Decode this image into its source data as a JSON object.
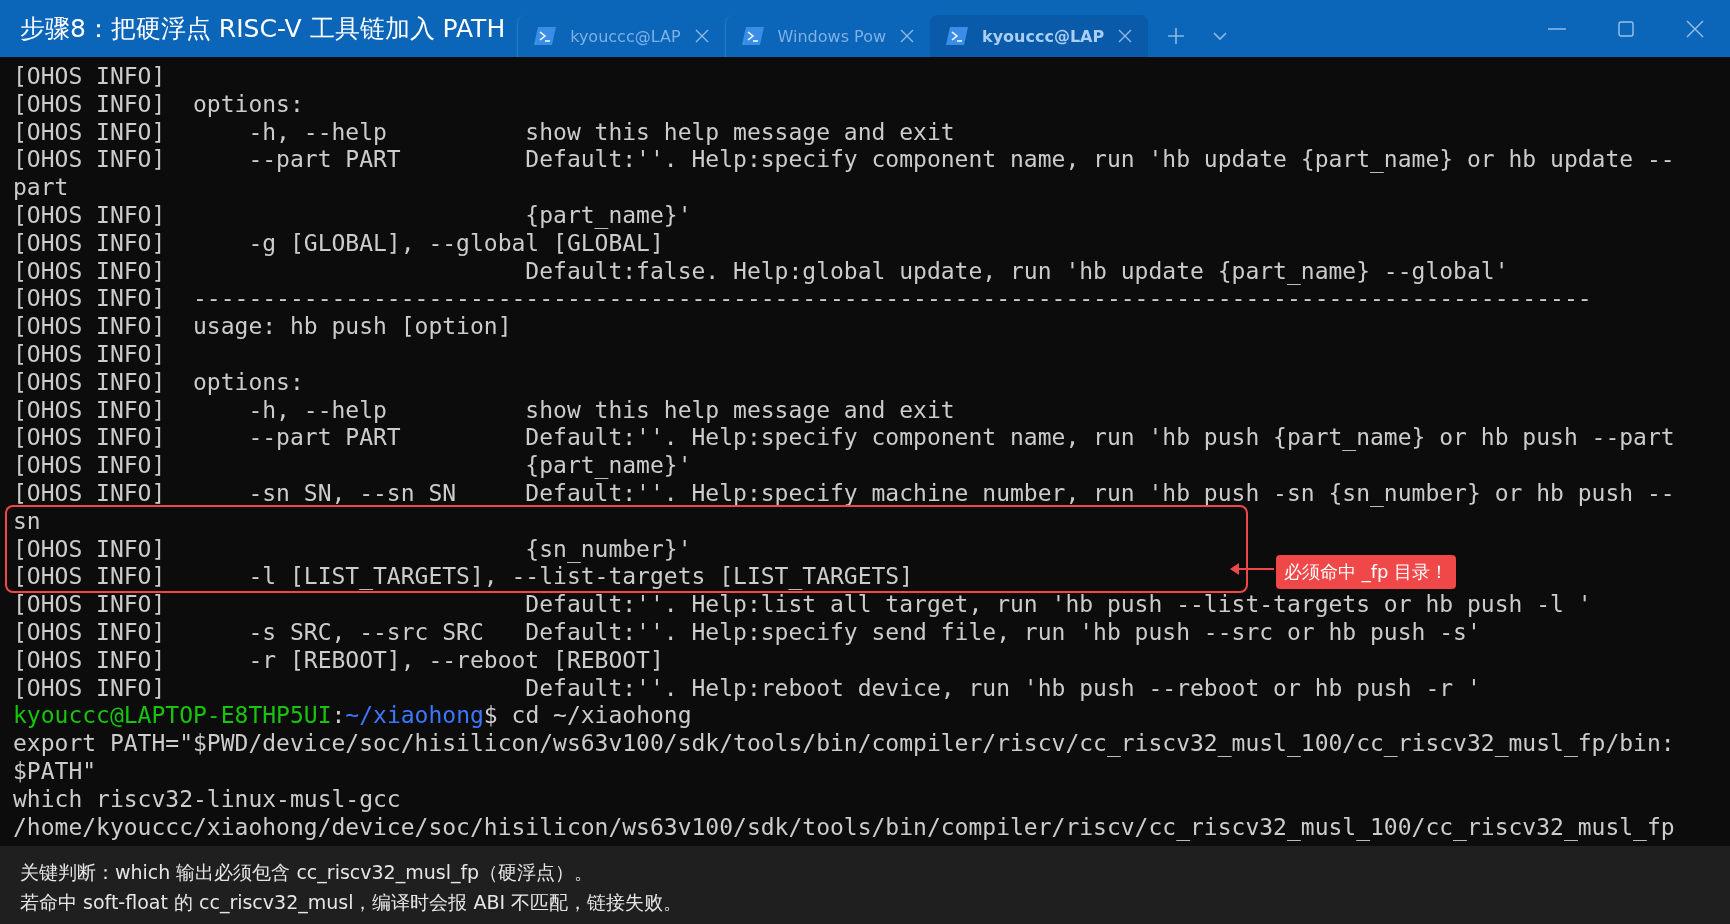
{
  "window": {
    "title": "步骤8：把硬浮点 RISC-V 工具链加入 PATH"
  },
  "tabs": [
    {
      "label": "kyouccc@LAP",
      "selected": false
    },
    {
      "label": "Windows Pow",
      "selected": false
    },
    {
      "label": "kyouccc@LAP",
      "selected": true
    }
  ],
  "terminal": {
    "lines": [
      {
        "kind": "text",
        "text": "[OHOS INFO]"
      },
      {
        "kind": "text",
        "text": "[OHOS INFO]  options:"
      },
      {
        "kind": "text",
        "text": "[OHOS INFO]      -h, --help          show this help message and exit"
      },
      {
        "kind": "text",
        "text": "[OHOS INFO]      --part PART         Default:''. Help:specify component name, run 'hb update {part_name} or hb update --"
      },
      {
        "kind": "text",
        "text": "part"
      },
      {
        "kind": "text",
        "text": "[OHOS INFO]                          {part_name}'"
      },
      {
        "kind": "text",
        "text": "[OHOS INFO]      -g [GLOBAL], --global [GLOBAL]"
      },
      {
        "kind": "text",
        "text": "[OHOS INFO]                          Default:false. Help:global update, run 'hb update {part_name} --global'"
      },
      {
        "kind": "text",
        "text": "[OHOS INFO]  -----------------------------------------------------------------------------------------------------"
      },
      {
        "kind": "text",
        "text": "[OHOS INFO]  usage: hb push [option]"
      },
      {
        "kind": "text",
        "text": "[OHOS INFO]"
      },
      {
        "kind": "text",
        "text": "[OHOS INFO]  options:"
      },
      {
        "kind": "text",
        "text": "[OHOS INFO]      -h, --help          show this help message and exit"
      },
      {
        "kind": "text",
        "text": "[OHOS INFO]      --part PART         Default:''. Help:specify component name, run 'hb push {part_name} or hb push --part"
      },
      {
        "kind": "text",
        "text": "[OHOS INFO]                          {part_name}'"
      },
      {
        "kind": "text",
        "text": "[OHOS INFO]      -sn SN, --sn SN     Default:''. Help:specify machine number, run 'hb push -sn {sn_number} or hb push --"
      },
      {
        "kind": "text",
        "text": "sn"
      },
      {
        "kind": "text",
        "text": "[OHOS INFO]                          {sn_number}'"
      },
      {
        "kind": "text",
        "text": "[OHOS INFO]      -l [LIST_TARGETS], --list-targets [LIST_TARGETS]"
      },
      {
        "kind": "text",
        "text": "[OHOS INFO]                          Default:''. Help:list all target, run 'hb push --list-targets or hb push -l '"
      },
      {
        "kind": "text",
        "text": "[OHOS INFO]      -s SRC, --src SRC   Default:''. Help:specify send file, run 'hb push --src or hb push -s'"
      },
      {
        "kind": "text",
        "text": "[OHOS INFO]      -r [REBOOT], --reboot [REBOOT]"
      },
      {
        "kind": "text",
        "text": "[OHOS INFO]                          Default:''. Help:reboot device, run 'hb push --reboot or hb push -r '"
      },
      {
        "kind": "prompt",
        "parts": [
          {
            "text": "kyouccc@LAPTOP-E8THP5UI",
            "color": "#16c60c"
          },
          {
            "text": ":",
            "color": "#cccccc"
          },
          {
            "text": "~/xiaohong",
            "color": "#3b78ff"
          },
          {
            "text": "$ cd ~/xiaohong",
            "color": "#cccccc"
          }
        ]
      },
      {
        "kind": "text",
        "text": "export PATH=\"$PWD/device/soc/hisilicon/ws63v100/sdk/tools/bin/compiler/riscv/cc_riscv32_musl_100/cc_riscv32_musl_fp/bin:"
      },
      {
        "kind": "text",
        "text": "$PATH\""
      },
      {
        "kind": "text",
        "text": "which riscv32-linux-musl-gcc"
      },
      {
        "kind": "text",
        "text": "/home/kyouccc/xiaohong/device/soc/hisilicon/ws63v100/sdk/tools/bin/compiler/riscv/cc_riscv32_musl_100/cc_riscv32_musl_fp"
      }
    ]
  },
  "annotation": {
    "label": "必须命中 _fp 目录！"
  },
  "caption": {
    "lines": [
      "关键判断：which 输出必须包含 cc_riscv32_musl_fp（硬浮点）。",
      "若命中 soft-float 的 cc_riscv32_musl，编译时会报 ABI 不匹配，链接失败。"
    ]
  }
}
